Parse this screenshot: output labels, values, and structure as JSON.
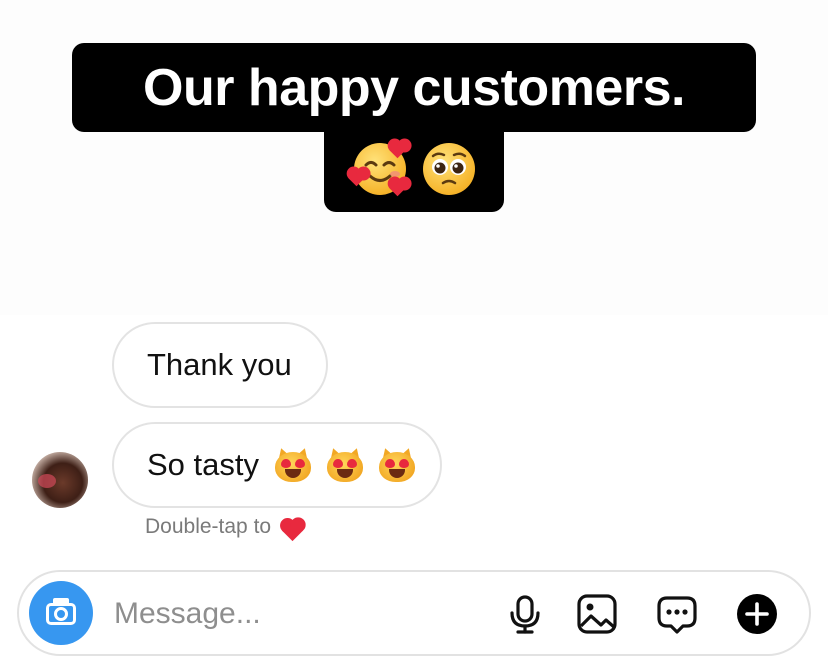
{
  "caption": {
    "line1": "Our happy customers.",
    "emojis": [
      "smiling-face-with-hearts-icon",
      "pleading-face-icon"
    ]
  },
  "chat": {
    "messages": [
      {
        "text": "Thank you",
        "emojis": []
      },
      {
        "text": "So tasty",
        "emojis": [
          "heart-eyes-cat-icon",
          "heart-eyes-cat-icon",
          "heart-eyes-cat-icon"
        ]
      }
    ],
    "hint": "Double-tap to",
    "hint_icon": "red-heart-icon"
  },
  "composer": {
    "placeholder": "Message...",
    "accent": "#3797f0",
    "tools": [
      "microphone-icon",
      "image-icon",
      "sticker-chat-icon",
      "plus-icon"
    ]
  }
}
